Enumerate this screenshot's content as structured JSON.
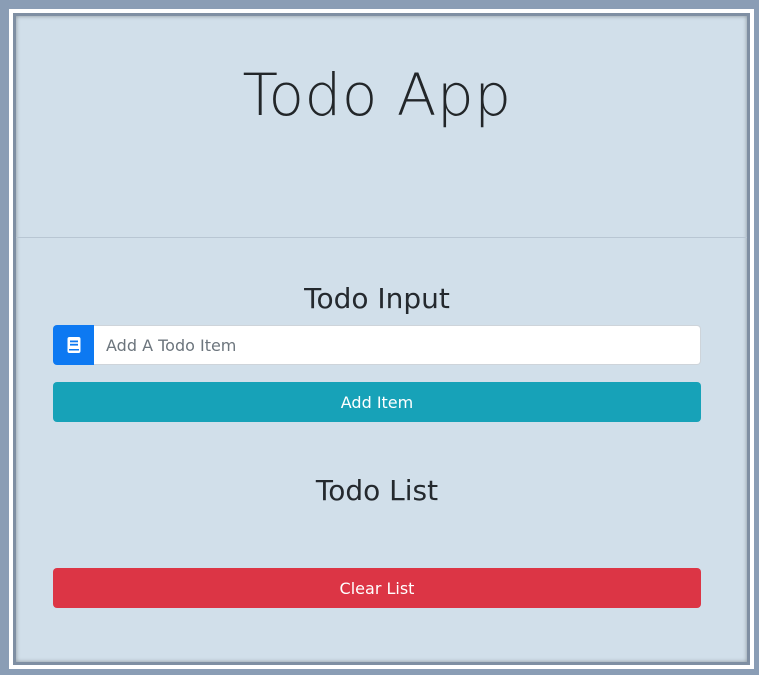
{
  "header": {
    "title": "Todo App"
  },
  "input_section": {
    "title": "Todo Input",
    "placeholder": "Add A Todo Item",
    "value": "",
    "icon": "book-icon",
    "icon_bg": "#0d79f2",
    "add_button_label": "Add Item",
    "add_button_color": "#17a2b8"
  },
  "list_section": {
    "title": "Todo List",
    "items": [],
    "clear_button_label": "Clear List",
    "clear_button_color": "#dc3545"
  }
}
